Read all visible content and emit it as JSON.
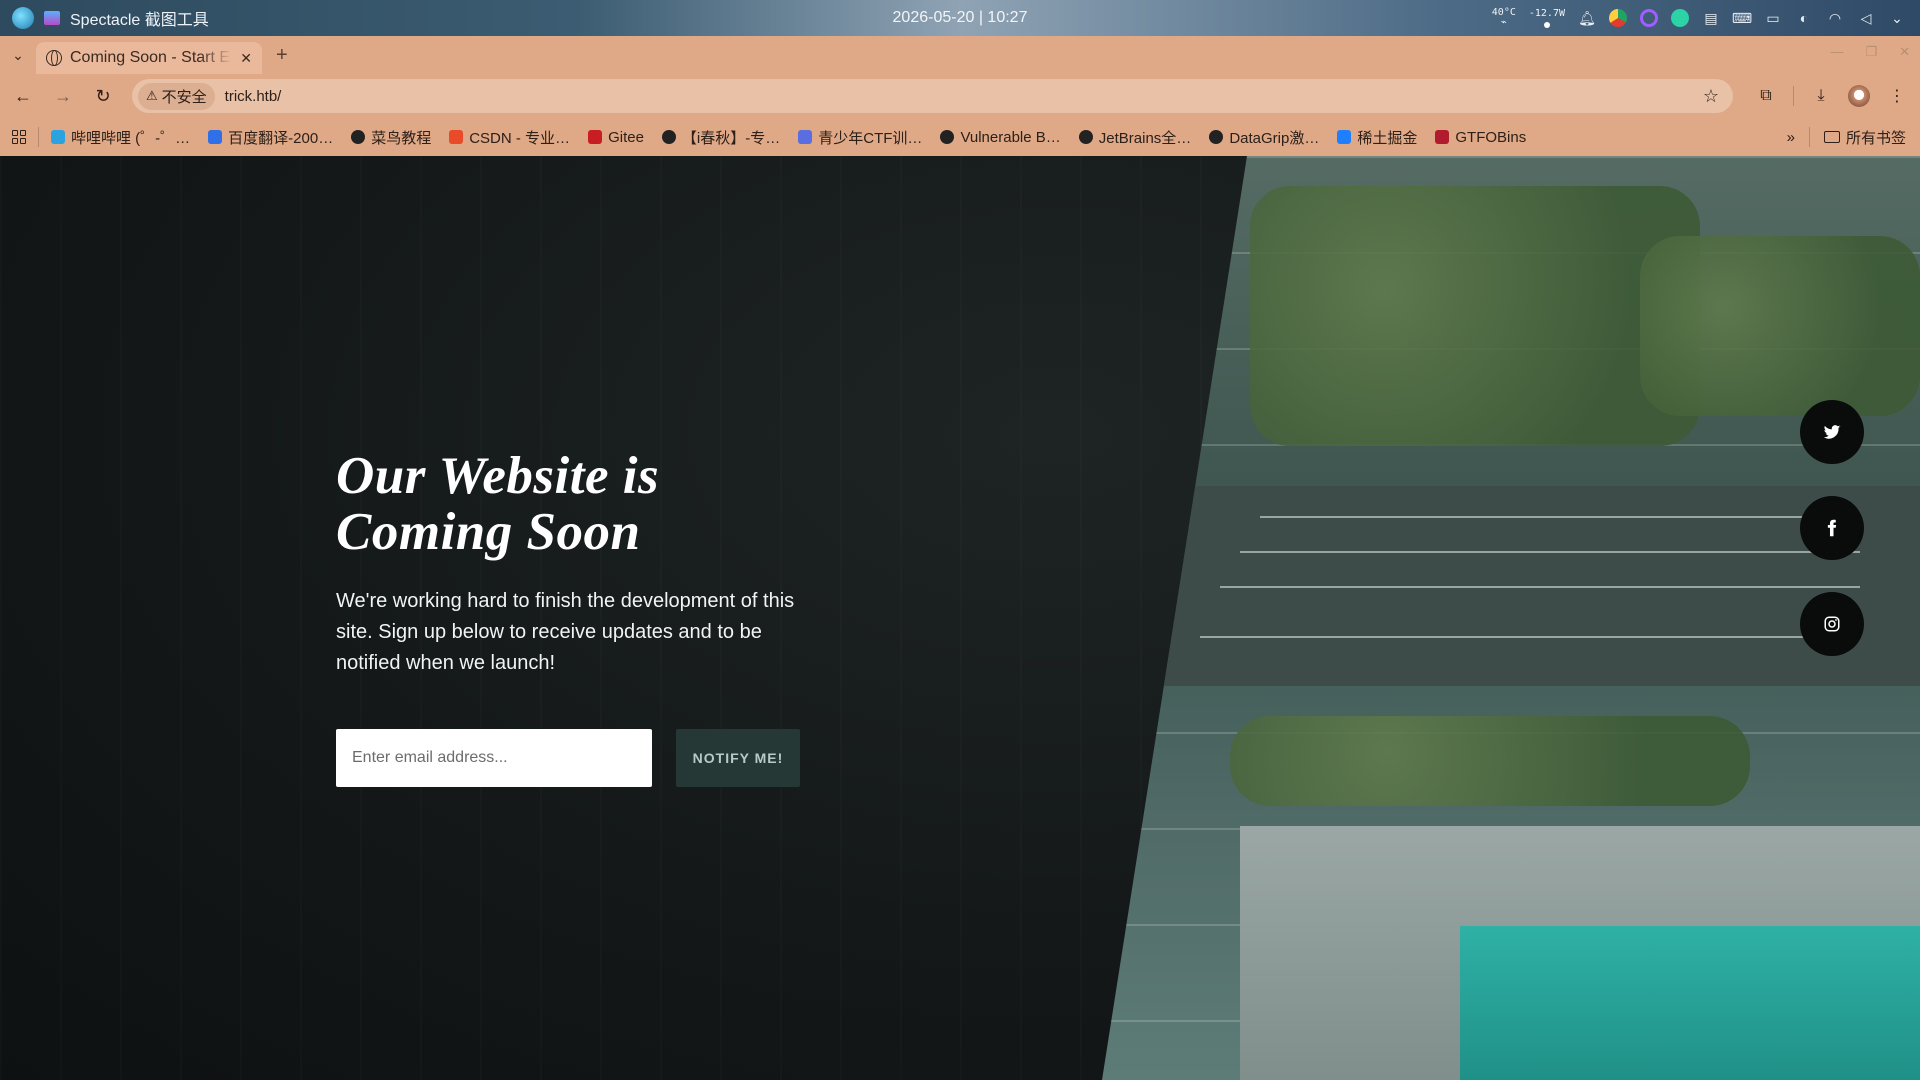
{
  "os_panel": {
    "app_title": "Spectacle 截图工具",
    "clock": "2026-05-20 | 10:27",
    "tray_temp": "40°C",
    "tray_power": "-12.7W",
    "tray_icons": [
      "bell-icon",
      "chromium-icon",
      "ring-icon",
      "x-app-icon",
      "clipboard-icon",
      "keyboard-icon",
      "monitor-icon",
      "cpu-icon",
      "wifi-icon",
      "volume-icon",
      "chevron-down-icon"
    ]
  },
  "browser": {
    "tab": {
      "title": "Coming Soon - Start E"
    },
    "address": {
      "security_label": "不安全",
      "url": "trick.htb/"
    },
    "bookmarks": [
      {
        "label": "哔哩哔哩 (゜-゜…",
        "color": "#2aa3e0"
      },
      {
        "label": "百度翻译-200…",
        "color": "#2f6fe8"
      },
      {
        "label": "菜鸟教程",
        "color": "#222222"
      },
      {
        "label": "CSDN - 专业…",
        "color": "#e84a2a"
      },
      {
        "label": "Gitee",
        "color": "#c71d23"
      },
      {
        "label": "【i春秋】-专…",
        "color": "#222222"
      },
      {
        "label": "青少年CTF训…",
        "color": "#5b6ee1"
      },
      {
        "label": "Vulnerable B…",
        "color": "#222222"
      },
      {
        "label": "JetBrains全…",
        "color": "#222222"
      },
      {
        "label": "DataGrip激…",
        "color": "#222222"
      },
      {
        "label": "稀土掘金",
        "color": "#1e80ff"
      },
      {
        "label": "GTFOBins",
        "color": "#b01c2e"
      }
    ],
    "all_bookmarks_label": "所有书签"
  },
  "page": {
    "title": "Our Website is Coming Soon",
    "description": "We're working hard to finish the development of this site. Sign up below to receive updates and to be notified when we launch!",
    "email_placeholder": "Enter email address...",
    "notify_button": "NOTIFY ME!",
    "social": [
      "twitter-icon",
      "facebook-icon",
      "instagram-icon"
    ],
    "accent_color": "#263835"
  }
}
